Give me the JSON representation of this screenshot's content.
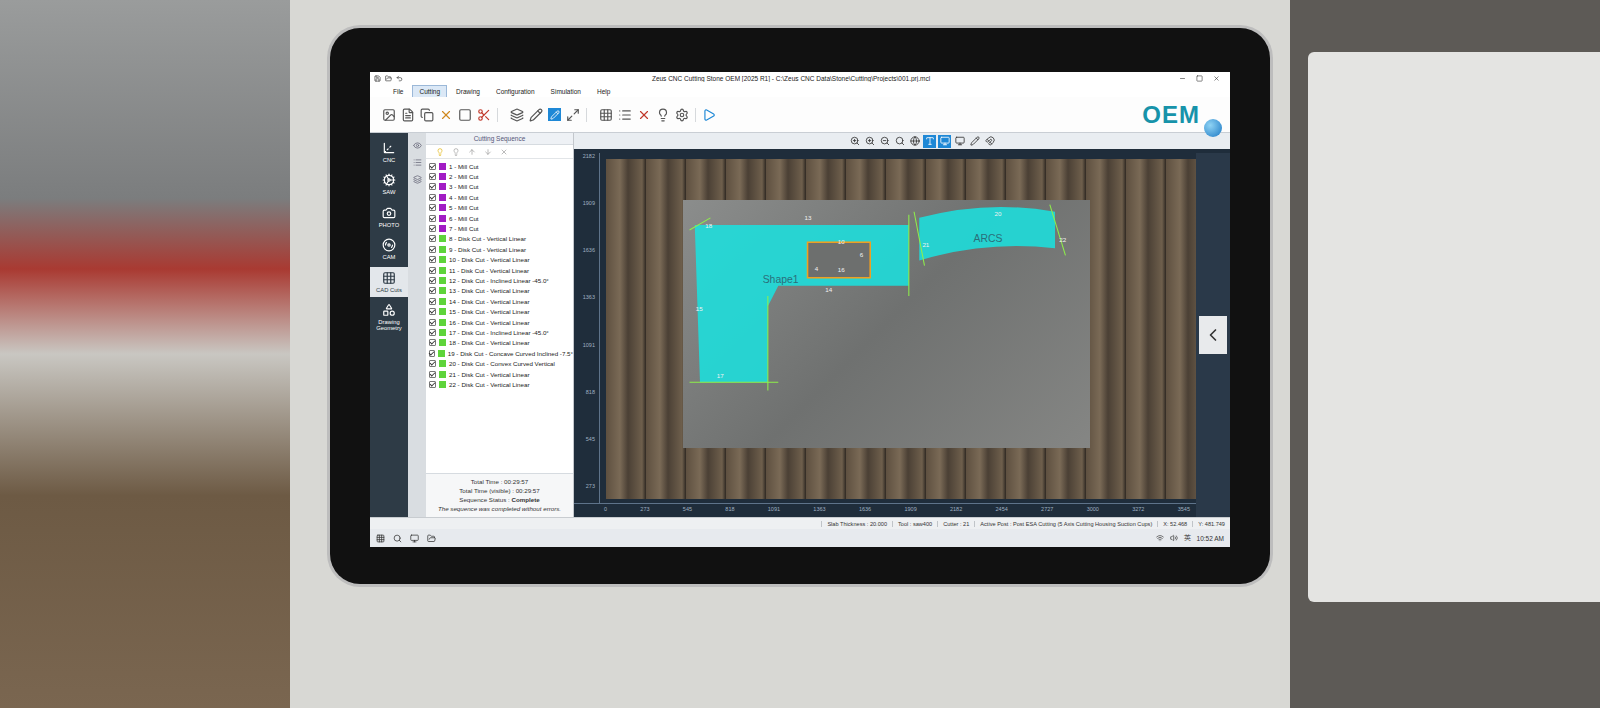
{
  "window": {
    "title": "Zeus CNC Cutting Stone OEM [2025 R1] - C:\\Zeus CNC Data\\Stone\\Cutting\\Projects\\001.prj.mcl"
  },
  "menu": [
    {
      "label": "File",
      "selected": false
    },
    {
      "label": "Cutting",
      "selected": true
    },
    {
      "label": "Drawing",
      "selected": false
    },
    {
      "label": "Configuration",
      "selected": false
    },
    {
      "label": "Simulation",
      "selected": false
    },
    {
      "label": "Help",
      "selected": false
    }
  ],
  "logo": "OEM",
  "sidebar": {
    "items": [
      {
        "label": "CNC",
        "selected": false
      },
      {
        "label": "SAW",
        "selected": false
      },
      {
        "label": "PHOTO",
        "selected": false
      },
      {
        "label": "CAM",
        "selected": false
      },
      {
        "label": "CAD Cuts",
        "selected": true
      },
      {
        "label": "Drawing Geometry",
        "selected": false
      }
    ]
  },
  "sequence": {
    "title": "Cutting Sequence",
    "items": [
      {
        "label": "1 - Mill Cut",
        "checked": true,
        "color": "#a21cc4"
      },
      {
        "label": "2 - Mill Cut",
        "checked": true,
        "color": "#a21cc4"
      },
      {
        "label": "3 - Mill Cut",
        "checked": true,
        "color": "#a21cc4"
      },
      {
        "label": "4 - Mill Cut",
        "checked": true,
        "color": "#a21cc4"
      },
      {
        "label": "5 - Mill Cut",
        "checked": true,
        "color": "#a21cc4"
      },
      {
        "label": "6 - Mill Cut",
        "checked": true,
        "color": "#a21cc4"
      },
      {
        "label": "7 - Mill Cut",
        "checked": true,
        "color": "#a21cc4"
      },
      {
        "label": "8 - Disk Cut - Vertical Linear",
        "checked": true,
        "color": "#5fd43a"
      },
      {
        "label": "9 - Disk Cut - Vertical Linear",
        "checked": true,
        "color": "#5fd43a"
      },
      {
        "label": "10 - Disk Cut - Vertical Linear",
        "checked": true,
        "color": "#5fd43a"
      },
      {
        "label": "11 - Disk Cut - Vertical Linear",
        "checked": true,
        "color": "#5fd43a"
      },
      {
        "label": "12 - Disk Cut - Inclined Linear -45.0°",
        "checked": true,
        "color": "#5fd43a"
      },
      {
        "label": "13 - Disk Cut - Vertical Linear",
        "checked": true,
        "color": "#5fd43a"
      },
      {
        "label": "14 - Disk Cut - Vertical Linear",
        "checked": true,
        "color": "#5fd43a"
      },
      {
        "label": "15 - Disk Cut - Vertical Linear",
        "checked": true,
        "color": "#5fd43a"
      },
      {
        "label": "16 - Disk Cut - Vertical Linear",
        "checked": true,
        "color": "#5fd43a"
      },
      {
        "label": "17 - Disk Cut - Inclined Linear -45.0°",
        "checked": true,
        "color": "#5fd43a"
      },
      {
        "label": "18 - Disk Cut - Vertical Linear",
        "checked": true,
        "color": "#5fd43a"
      },
      {
        "label": "19 - Disk Cut - Concave Curved Inclined -7.5°",
        "checked": true,
        "color": "#5fd43a"
      },
      {
        "label": "20 - Disk Cut - Convex Curved Vertical",
        "checked": true,
        "color": "#5fd43a"
      },
      {
        "label": "21 - Disk Cut - Vertical Linear",
        "checked": true,
        "color": "#5fd43a"
      },
      {
        "label": "22 - Disk Cut - Vertical Linear",
        "checked": true,
        "color": "#5fd43a"
      }
    ],
    "total_time": "Total Time : 00:29:57",
    "total_time_visible": "Total Time (visible) : 00:29:57",
    "status_label": "Sequence Status : ",
    "status_value": "Complete",
    "status_message": "The sequence was completed without errors."
  },
  "canvas_tools": [
    {
      "selected": false
    },
    {
      "selected": false
    },
    {
      "selected": false
    },
    {
      "selected": false
    },
    {
      "selected": false
    },
    {
      "selected": true
    },
    {
      "selected": true
    },
    {
      "selected": false
    },
    {
      "selected": false
    },
    {
      "selected": false
    }
  ],
  "canvas": {
    "y_ticks": [
      "2182",
      "1909",
      "1636",
      "1363",
      "1091",
      "818",
      "545",
      "273"
    ],
    "x_ticks": [
      "0",
      "273",
      "545",
      "818",
      "1091",
      "1363",
      "1636",
      "1909",
      "2182",
      "2454",
      "2727",
      "3000",
      "3272",
      "3545"
    ],
    "labels": [
      "18",
      "13",
      "Shape1",
      "14",
      "15",
      "17",
      "ARCS",
      "20",
      "21",
      "22",
      "10",
      "4",
      "6",
      "16"
    ]
  },
  "status_bar": [
    "Slab Thickness : 20.000",
    "Tool : saw400",
    "Cutter : 21",
    "Active Post : Post ESA Cutting (5 Axis Cutting Housing Suction Cups)",
    "X: 52.468",
    "Y: 481.749"
  ],
  "taskbar": {
    "tray": "英",
    "time": "10:52 AM"
  }
}
